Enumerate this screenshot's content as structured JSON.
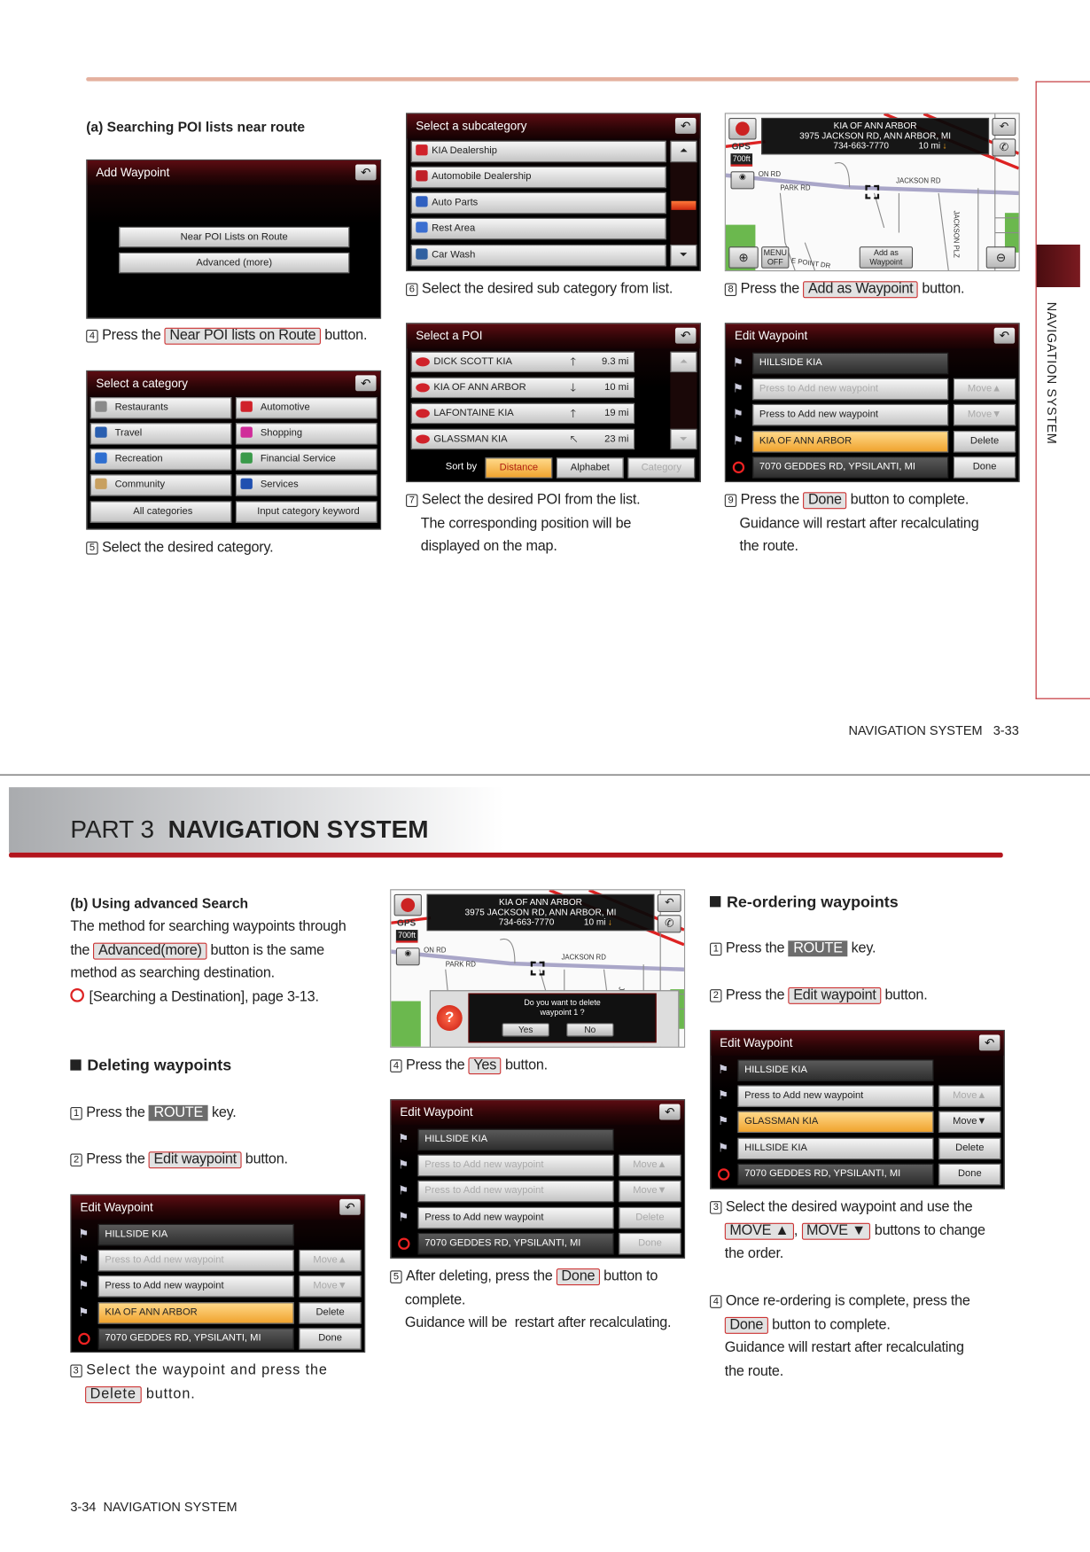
{
  "top": {
    "section_a_title": "(a) Searching POI lists near route",
    "side_tab": "NAVIGATION SYSTEM",
    "footer": "NAVIGATION SYSTEM   3-33"
  },
  "bottom": {
    "part_label": "PART 3",
    "part_title": "NAVIGATION SYSTEM",
    "section_b_title": "(b) Using advanced Search",
    "deleting_heading": "Deleting waypoints",
    "reordering_heading": "Re-ordering waypoints",
    "footer": "3-34  NAVIGATION SYSTEM"
  },
  "captions": {
    "a4": {
      "num": "4",
      "lines": [
        [
          {
            "t": "Press the "
          },
          {
            "k": "Near POI lists on Route"
          },
          {
            "t": " button."
          }
        ]
      ]
    },
    "a5": {
      "num": "5",
      "lines": [
        [
          {
            "t": "Select the desired category."
          }
        ]
      ]
    },
    "a6": {
      "num": "6",
      "lines": [
        [
          {
            "t": "Select the desired sub category from list."
          }
        ]
      ]
    },
    "a7": {
      "num": "7",
      "lines": [
        [
          {
            "t": "Select the desired POI from the list."
          }
        ],
        [
          {
            "t": "The corresponding position will be"
          }
        ],
        [
          {
            "t": "displayed on the map."
          }
        ]
      ]
    },
    "a8": {
      "num": "8",
      "lines": [
        [
          {
            "t": "Press the "
          },
          {
            "k": "Add as Waypoint"
          },
          {
            "t": " button."
          }
        ]
      ]
    },
    "a9": {
      "num": "9",
      "lines": [
        [
          {
            "t": "Press the "
          },
          {
            "k": "Done"
          },
          {
            "t": " button to complete."
          }
        ],
        [
          {
            "t": "Guidance will restart after recalculating"
          }
        ],
        [
          {
            "t": "the route."
          }
        ]
      ]
    },
    "b_intro": {
      "lines": [
        [
          {
            "t": "The method for searching waypoints through"
          }
        ],
        [
          {
            "t": "the "
          },
          {
            "k": "Advanced(more)"
          },
          {
            "t": " button is the same"
          }
        ],
        [
          {
            "t": "method as searching destination."
          }
        ],
        [
          {
            "ref": "reference-icon"
          },
          {
            "t": "[Searching a Destination], page 3-13."
          }
        ]
      ]
    },
    "d1": {
      "num": "1",
      "lines": [
        [
          {
            "t": "Press the "
          },
          {
            "r": "ROUTE"
          },
          {
            "t": " key."
          }
        ]
      ]
    },
    "d2": {
      "num": "2",
      "lines": [
        [
          {
            "t": "Press the "
          },
          {
            "k": "Edit waypoint"
          },
          {
            "t": " button."
          }
        ]
      ]
    },
    "d3": {
      "num": "3",
      "lines": [
        [
          {
            "t": "Select the waypoint and press the"
          }
        ],
        [
          {
            "k": "Delete"
          },
          {
            "t": " button."
          }
        ]
      ]
    },
    "d4": {
      "num": "4",
      "lines": [
        [
          {
            "t": "Press the "
          },
          {
            "k": "Yes"
          },
          {
            "t": " button."
          }
        ]
      ]
    },
    "d5": {
      "num": "5",
      "lines": [
        [
          {
            "t": "After deleting, press the "
          },
          {
            "k": "Done"
          },
          {
            "t": " button to"
          }
        ],
        [
          {
            "t": "complete."
          }
        ],
        [
          {
            "t": "Guidance will be  restart after recalculating."
          }
        ]
      ]
    },
    "r1": {
      "num": "1",
      "lines": [
        [
          {
            "t": "Press the "
          },
          {
            "r": "ROUTE"
          },
          {
            "t": " key."
          }
        ]
      ]
    },
    "r2": {
      "num": "2",
      "lines": [
        [
          {
            "t": "Press the "
          },
          {
            "k": "Edit waypoint"
          },
          {
            "t": " button."
          }
        ]
      ]
    },
    "r3": {
      "num": "3",
      "lines": [
        [
          {
            "t": "Select the desired waypoint and use the"
          }
        ],
        [
          {
            "k": "MOVE ▲"
          },
          {
            "t": ", "
          },
          {
            "k": "MOVE ▼"
          },
          {
            "t": " buttons to change"
          }
        ],
        [
          {
            "t": "the order."
          }
        ]
      ]
    },
    "r4": {
      "num": "4",
      "lines": [
        [
          {
            "t": "Once re-ordering is complete, press the"
          }
        ],
        [
          {
            "k": "Done"
          },
          {
            "t": " button to complete."
          }
        ],
        [
          {
            "t": "Guidance will restart after recalculating"
          }
        ],
        [
          {
            "t": "the route."
          }
        ]
      ]
    }
  },
  "screens": {
    "add_waypoint": {
      "title": "Add Waypoint",
      "back_icon": "back-icon",
      "buttons": [
        "Near POI Lists on Route",
        "Advanced (more)"
      ]
    },
    "category": {
      "title": "Select a category",
      "items": [
        {
          "label": "Restaurants",
          "icon": "restaurants-icon",
          "color": "#8a8a8a"
        },
        {
          "label": "Automotive",
          "icon": "car-icon",
          "color": "#d0222a"
        },
        {
          "label": "Travel",
          "icon": "travel-icon",
          "color": "#2a5fb0"
        },
        {
          "label": "Shopping",
          "icon": "shopping-icon",
          "color": "#d02c9a"
        },
        {
          "label": "Recreation",
          "icon": "recreation-icon",
          "color": "#2f6fd0"
        },
        {
          "label": "Financial Service",
          "icon": "financial-icon",
          "color": "#3a9a4a"
        },
        {
          "label": "Community",
          "icon": "community-icon",
          "color": "#c8a060"
        },
        {
          "label": "Services",
          "icon": "services-icon",
          "color": "#2050b0"
        },
        {
          "label": "All categories"
        },
        {
          "label": "Input category keyword"
        }
      ]
    },
    "subcategory": {
      "title": "Select a subcategory",
      "items": [
        {
          "label": "KIA Dealership",
          "icon": "kia-logo-icon",
          "color": "#d0222a"
        },
        {
          "label": "Automobile Dealership",
          "icon": "car-icon",
          "color": "#c02028"
        },
        {
          "label": "Auto Parts",
          "icon": "auto-parts-icon",
          "color": "#3060c0"
        },
        {
          "label": "Rest Area",
          "icon": "rest-area-icon",
          "color": "#3a6ed0"
        },
        {
          "label": "Car Wash",
          "icon": "car-wash-icon",
          "color": "#3060a0"
        }
      ]
    },
    "poi": {
      "title": "Select a POI",
      "rows": [
        {
          "name": "DICK SCOTT KIA",
          "dir": "🡑",
          "dist": "9.3 mi"
        },
        {
          "name": "KIA OF ANN ARBOR",
          "dir": "🡓",
          "dist": "10 mi"
        },
        {
          "name": "LAFONTAINE KIA",
          "dir": "🡑",
          "dist": "19 mi"
        },
        {
          "name": "GLASSMAN KIA",
          "dir": "🡔",
          "dist": "23 mi"
        }
      ],
      "sort_label": "Sort by",
      "sort_options": [
        "Distance",
        "Alphabet",
        "Category"
      ],
      "selected_sort": "Distance"
    },
    "map_info": {
      "gps": "GPS",
      "scale": "700ft",
      "name": "KIA OF ANN ARBOR",
      "address": "3975 JACKSON RD, ANN ARBOR, MI",
      "phone": "734-663-7770",
      "distance": "10 mi",
      "roads": {
        "park": "PARK RD",
        "jackson": "JACKSON RD",
        "plz": "JACKSON PLZ",
        "on": "ON RD",
        "point": "E POINT DR"
      },
      "menu_off": "MENU OFF",
      "add_waypoint": "Add as Waypoint"
    },
    "delete_dialog": {
      "question": "Do you want to delete waypoint 1 ?",
      "yes": "Yes",
      "no": "No"
    },
    "edit_a": {
      "title": "Edit Waypoint",
      "rows": [
        {
          "label": "HILLSIDE KIA",
          "state": "dark",
          "icon": "flag"
        },
        {
          "label": "Press to Add new waypoint",
          "state": "dim",
          "icon": "flag",
          "action": "Move▲",
          "action_state": "dim"
        },
        {
          "label": "Press to Add new waypoint",
          "state": "normal",
          "icon": "flag",
          "action": "Move▼",
          "action_state": "dim"
        },
        {
          "label": "KIA OF ANN ARBOR",
          "state": "selected",
          "icon": "flag",
          "action": "Delete",
          "action_state": "normal"
        },
        {
          "label": "7070 GEDDES RD, YPSILANTI, MI",
          "state": "dark",
          "icon": "dest",
          "action": "Done",
          "action_state": "normal"
        }
      ]
    },
    "edit_b": {
      "title": "Edit Waypoint",
      "rows": [
        {
          "label": "HILLSIDE KIA",
          "state": "dark",
          "icon": "flag"
        },
        {
          "label": "Press to Add new waypoint",
          "state": "dim",
          "icon": "flag",
          "action": "Move▲",
          "action_state": "dim"
        },
        {
          "label": "Press to Add new waypoint",
          "state": "normal",
          "icon": "flag",
          "action": "Move▼",
          "action_state": "dim"
        },
        {
          "label": "KIA OF ANN ARBOR",
          "state": "selected",
          "icon": "flag",
          "action": "Delete",
          "action_state": "normal"
        },
        {
          "label": "7070 GEDDES RD, YPSILANTI, MI",
          "state": "dark",
          "icon": "dest",
          "action": "Done",
          "action_state": "normal"
        }
      ]
    },
    "edit_c": {
      "title": "Edit Waypoint",
      "rows": [
        {
          "label": "HILLSIDE KIA",
          "state": "dark",
          "icon": "flag"
        },
        {
          "label": "Press to Add new waypoint",
          "state": "dim",
          "icon": "flag",
          "action": "Move▲",
          "action_state": "dim"
        },
        {
          "label": "Press to Add new waypoint",
          "state": "dim",
          "icon": "flag",
          "action": "Move▼",
          "action_state": "dim"
        },
        {
          "label": "Press to Add new waypoint",
          "state": "normal",
          "icon": "flag",
          "action": "Delete",
          "action_state": "dim"
        },
        {
          "label": "7070 GEDDES RD, YPSILANTI, MI",
          "state": "dark",
          "icon": "dest",
          "action": "Done",
          "action_state": "dim"
        }
      ]
    },
    "edit_d": {
      "title": "Edit Waypoint",
      "rows": [
        {
          "label": "HILLSIDE KIA",
          "state": "dark",
          "icon": "flag"
        },
        {
          "label": "Press to Add new waypoint",
          "state": "normal",
          "icon": "flag",
          "action": "Move▲",
          "action_state": "dim"
        },
        {
          "label": "GLASSMAN KIA",
          "state": "selected",
          "icon": "flag",
          "action": "Move▼",
          "action_state": "normal"
        },
        {
          "label": "HILLSIDE KIA",
          "state": "normal",
          "icon": "flag",
          "action": "Delete",
          "action_state": "normal"
        },
        {
          "label": "7070 GEDDES RD, YPSILANTI, MI",
          "state": "dark",
          "icon": "dest",
          "action": "Done",
          "action_state": "normal"
        }
      ]
    }
  },
  "colors": {
    "accent_red": "#b3151d",
    "rule_orange": "#e4b09e",
    "selected_orange": "#f0a32e"
  }
}
